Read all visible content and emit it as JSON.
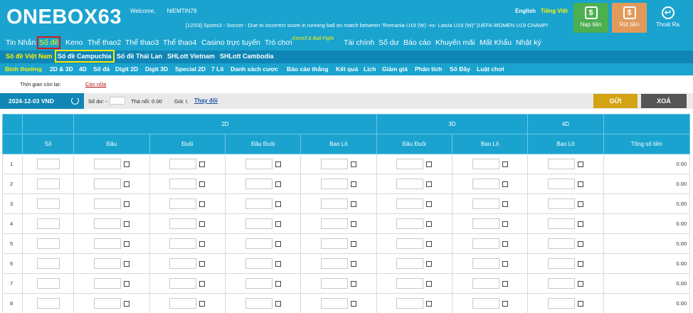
{
  "header": {
    "logo": "ONEBOX63",
    "welcome_label": "Welcome,",
    "username": "NIEMTIN79",
    "ticker": "[12/03] Sports3 - Soccer - Due to incorrect score in running ball on match between \"Romania U19 (W) -vs- Latvia U19 (W)\" [UEFA WOMEN U19 CHAMPI",
    "lang_en": "English",
    "lang_vi": "Tiếng Việt",
    "buttons": {
      "deposit": "Nạp tiền",
      "withdraw": "Rút tiền",
      "logout": "Thoát Ra"
    }
  },
  "nav_main": {
    "items": [
      "Tin Nhắn",
      "Số đề",
      "Keno",
      "Thể thao2",
      "Thể thao3",
      "Thể thao4",
      "Casino trực tuyến",
      "Trò chơi",
      "Tài chính",
      "Số dư",
      "Báo cáo",
      "Khuyến mãi",
      "Mất Khẩu",
      "Nhật ký"
    ],
    "superscript": "Keno3 & Ball Fight"
  },
  "nav_sub": {
    "items": [
      "Số đề Việt Nam",
      "Số đề Campuchia",
      "Số đề Thái Lan",
      "SHLott Vietnam",
      "SHLott Cambodia"
    ]
  },
  "nav_tabs": {
    "items": [
      "Bình thường",
      "2D & 3D",
      "4D",
      "Số đá",
      "Digit 2D",
      "Digit 3D",
      "Special 2D",
      "7 Lô",
      "Danh sách cược",
      "Báo cáo thắng",
      "Kết quả",
      "Lịch",
      "Giảm giá",
      "Phân tích",
      "Số Đầy",
      "Luật chơi"
    ]
  },
  "info": {
    "label": "Thời gian còn lại:",
    "value": "Còn nữa"
  },
  "controls": {
    "date": "2024-12-03 VND",
    "so_du": "Số dư: -",
    "tha_noi": "Thả nổi: 0.00",
    "goi": "Gói: I.",
    "thay_doi": "Thay đổi",
    "submit": "GỬI",
    "clear": "XOÁ"
  },
  "table": {
    "group_headers": [
      "2D",
      "3D",
      "4D"
    ],
    "columns": [
      "Số",
      "Đầu",
      "Đuôi",
      "Đầu Đuôi",
      "Bao Lô",
      "Đầu Đuôi",
      "Bao Lô",
      "Bao Lô",
      "Tổng số tiền"
    ],
    "rows": [
      {
        "index": "1",
        "total": "0.00"
      },
      {
        "index": "2",
        "total": "0.00"
      },
      {
        "index": "3",
        "total": "0.00"
      },
      {
        "index": "4",
        "total": "0.00"
      },
      {
        "index": "5",
        "total": "0.00"
      },
      {
        "index": "6",
        "total": "0.00"
      },
      {
        "index": "7",
        "total": "0.00"
      },
      {
        "index": "8",
        "total": "0.00"
      }
    ]
  },
  "colors": {
    "primary": "#1aa3cf",
    "dark": "#0f86b5",
    "highlight": "#fff200",
    "gold": "#d4a314",
    "gray": "#555555",
    "green": "#4caf50",
    "orange": "#e29a5b"
  }
}
